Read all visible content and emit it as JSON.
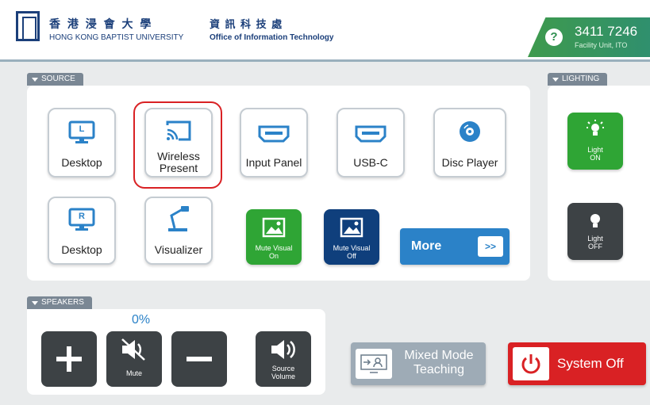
{
  "header": {
    "university_cn": "香 港 浸 會 大 學",
    "university_en": "HONG KONG BAPTIST UNIVERSITY",
    "office_cn": "資 訊 科 技 處",
    "office_en": "Office of Information Technology",
    "help_icon": "?",
    "help_phone": "3411 7246",
    "help_sub": "Facility Unit, ITO"
  },
  "source": {
    "tab_label": "SOURCE",
    "buttons": [
      {
        "label": "Desktop",
        "letter": "L",
        "icon": "monitor-icon"
      },
      {
        "label": "Wireless Present",
        "icon": "cast-icon"
      },
      {
        "label": "Input Panel",
        "icon": "hdmi-icon"
      },
      {
        "label": "USB-C",
        "icon": "hdmi-icon"
      },
      {
        "label": "Disc Player",
        "icon": "disc-icon"
      },
      {
        "label": "Desktop",
        "letter": "R",
        "icon": "monitor-icon"
      },
      {
        "label": "Visualizer",
        "icon": "visualizer-icon"
      }
    ],
    "mute_visual_on": "Mute Visual On",
    "mute_visual_off": "Mute Visual Off",
    "more_label": "More",
    "more_arrow": ">>"
  },
  "lighting": {
    "tab_label": "LIGHTING",
    "light_on": "Light ON",
    "light_off": "Light OFF"
  },
  "speakers": {
    "tab_label": "SPEAKERS",
    "volume": "0%",
    "mute_label": "Mute",
    "source_volume_label": "Source Volume"
  },
  "mixed_mode": "Mixed Mode Teaching",
  "system_off": "System Off",
  "colors": {
    "accent_blue": "#2b82c8",
    "green": "#2fa535",
    "navy": "#0f3f7c",
    "red": "#d92124"
  }
}
